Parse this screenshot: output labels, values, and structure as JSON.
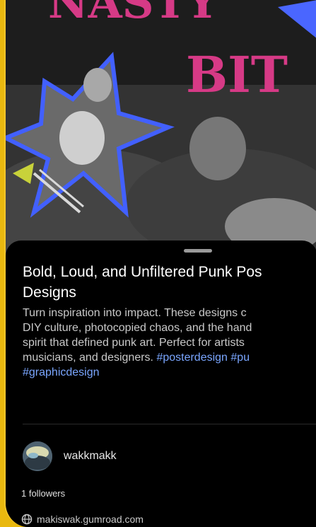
{
  "hero": {
    "title_fragment_top": "NASTY",
    "title_fragment_bottom": "BIT"
  },
  "pin": {
    "title_line1": "Bold, Loud, and Unfiltered Punk Pos",
    "title_line2": "Designs",
    "description_lines": [
      "Turn inspiration into impact. These designs c",
      "DIY culture, photocopied chaos, and the hand",
      "spirit that defined punk art. Perfect for artists",
      "musicians, and designers. "
    ],
    "hashtags": [
      "#posterdesign",
      "#pu",
      "#graphicdesign"
    ]
  },
  "creator": {
    "username": "wakkmakk",
    "followers": "1 followers",
    "link": "makiswak.gumroad.com"
  },
  "colors": {
    "frame": "#e9b80f",
    "hashtag": "#7aa6ff",
    "accent_pink": "#d63a86"
  }
}
